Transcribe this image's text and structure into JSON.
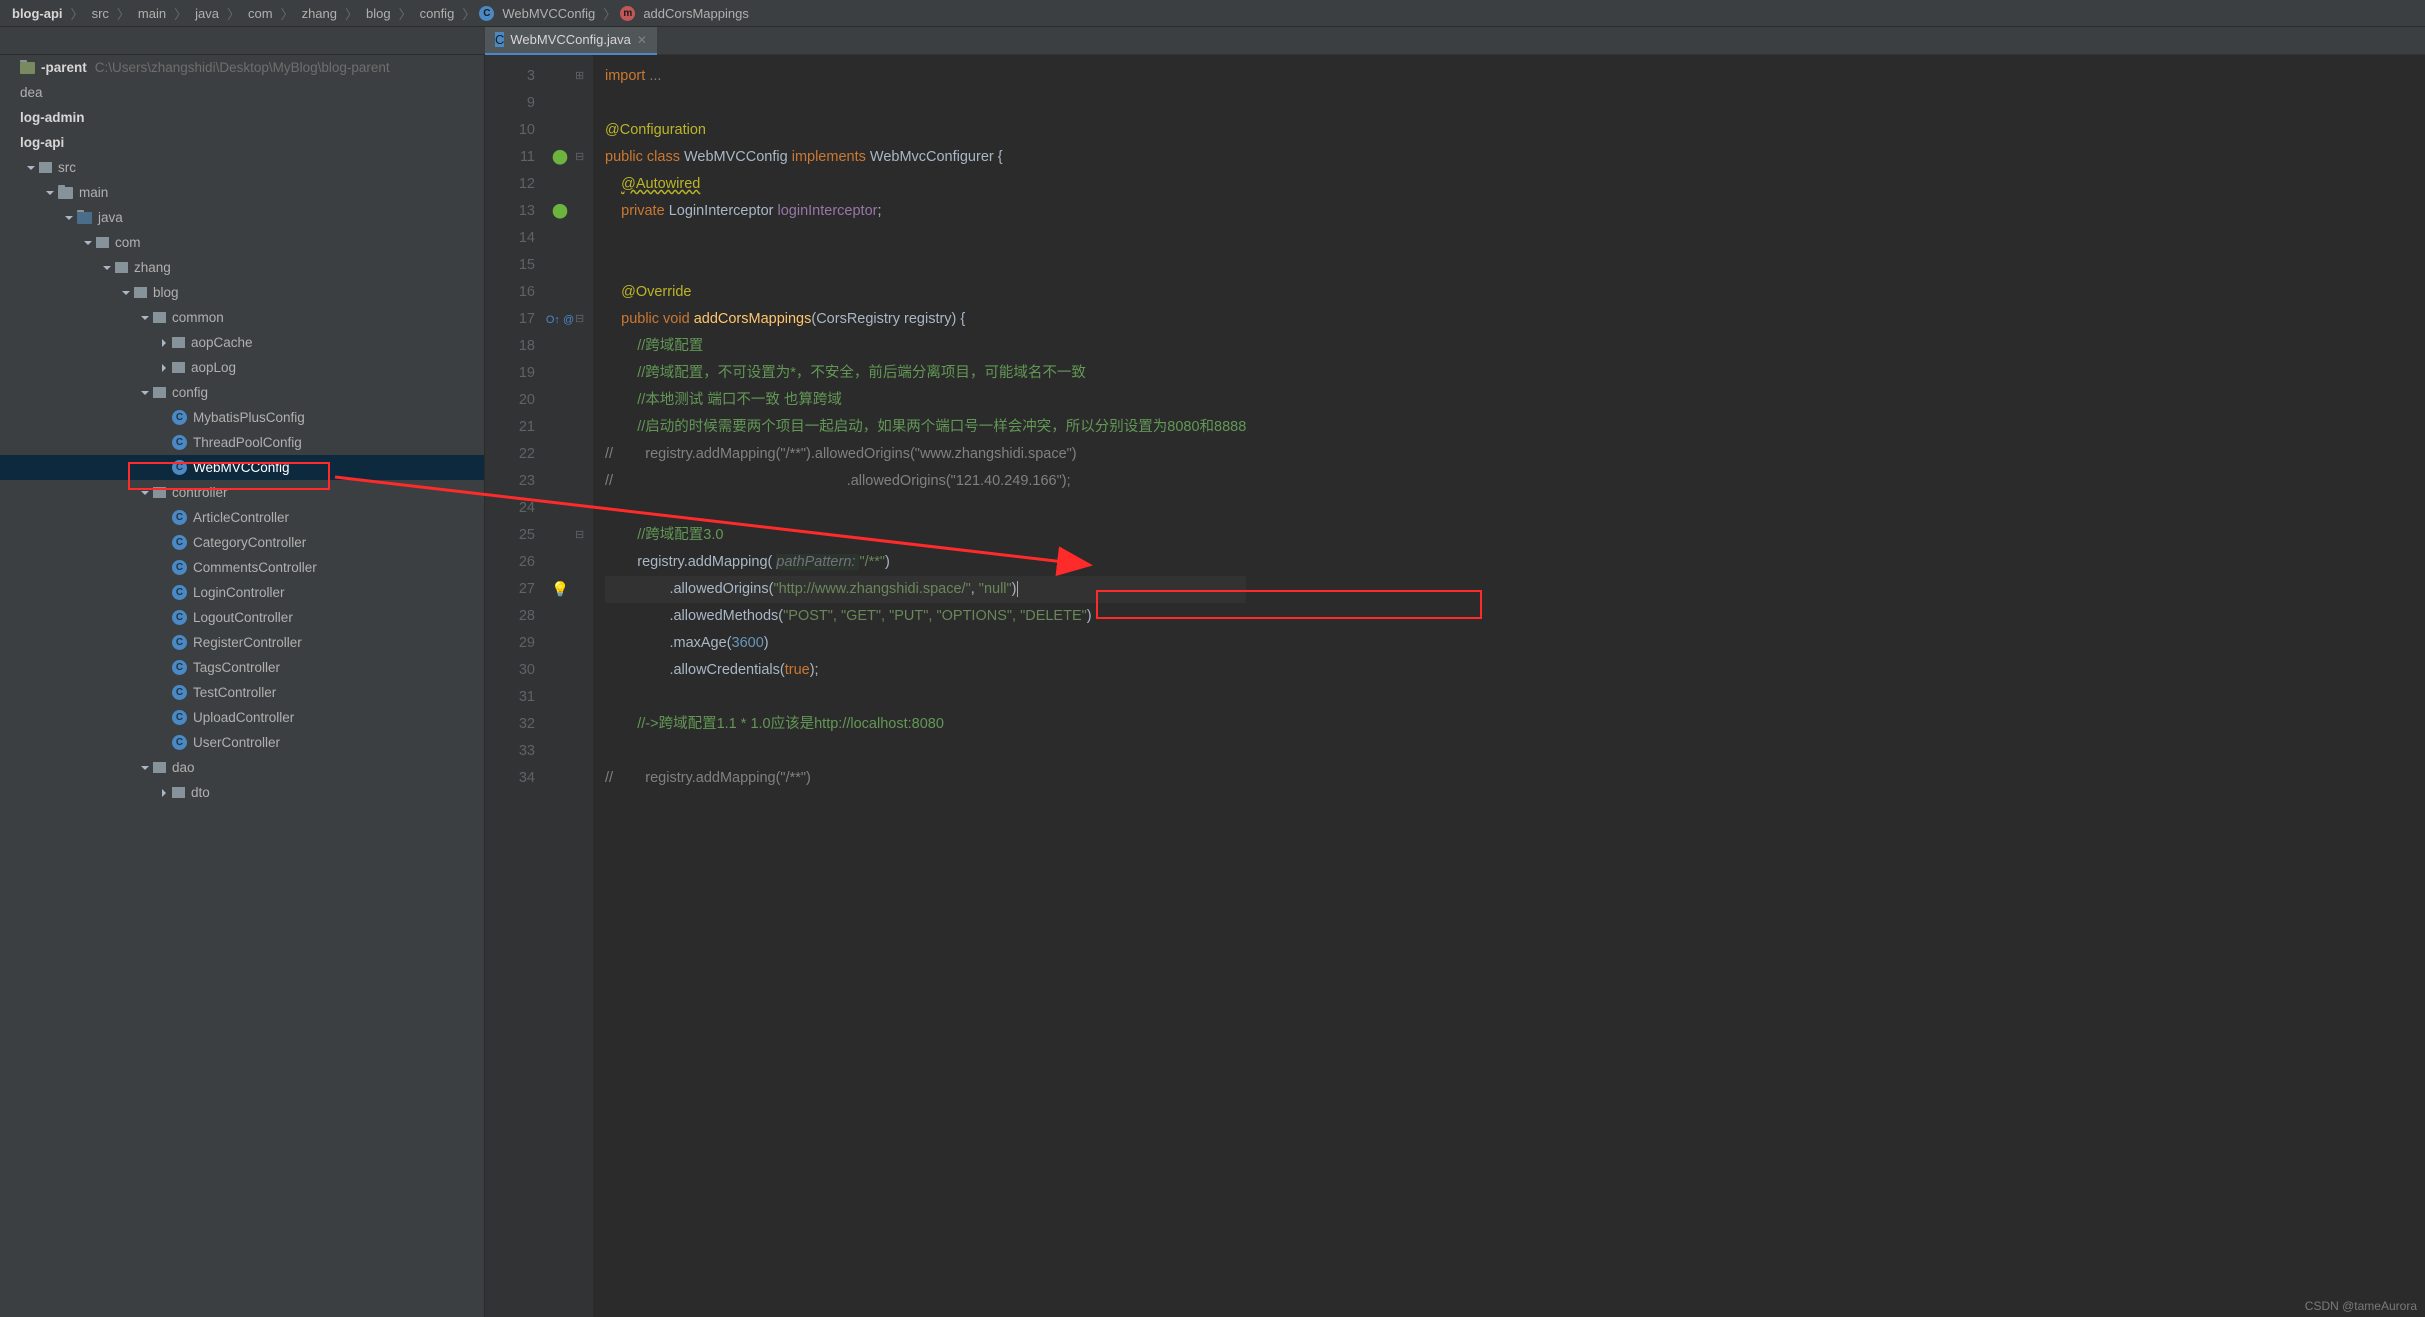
{
  "breadcrumbs": [
    "blog-api",
    "src",
    "main",
    "java",
    "com",
    "zhang",
    "blog",
    "config",
    "WebMVCConfig",
    "addCorsMappings"
  ],
  "tab": {
    "name": "WebMVCConfig.java"
  },
  "project": {
    "root": "-parent",
    "root_path": "C:\\Users\\zhangshidi\\Desktop\\MyBlog\\blog-parent",
    "items": [
      "dea",
      "log-admin",
      "log-api"
    ]
  },
  "tree": [
    {
      "lvl": 0,
      "icon": "root",
      "label": "-parent",
      "extra": "C:\\Users\\zhangshidi\\Desktop\\MyBlog\\blog-parent",
      "bold": true
    },
    {
      "lvl": 0,
      "icon": "",
      "label": "dea"
    },
    {
      "lvl": 0,
      "icon": "",
      "label": "log-admin",
      "bold": true
    },
    {
      "lvl": 0,
      "icon": "",
      "label": "log-api",
      "bold": true
    },
    {
      "lvl": 1,
      "icon": "pkg",
      "label": "src",
      "arrow": "down"
    },
    {
      "lvl": 2,
      "icon": "folder",
      "label": "main",
      "arrow": "down"
    },
    {
      "lvl": 3,
      "icon": "folder",
      "label": "java",
      "arrow": "down",
      "blue": true
    },
    {
      "lvl": 4,
      "icon": "pkg",
      "label": "com",
      "arrow": "down"
    },
    {
      "lvl": 5,
      "icon": "pkg",
      "label": "zhang",
      "arrow": "down"
    },
    {
      "lvl": 6,
      "icon": "pkg",
      "label": "blog",
      "arrow": "down"
    },
    {
      "lvl": 7,
      "icon": "pkg",
      "label": "common",
      "arrow": "down"
    },
    {
      "lvl": 8,
      "icon": "pkg",
      "label": "aopCache",
      "arrow": "right"
    },
    {
      "lvl": 8,
      "icon": "pkg",
      "label": "aopLog",
      "arrow": "right"
    },
    {
      "lvl": 7,
      "icon": "pkg",
      "label": "config",
      "arrow": "down"
    },
    {
      "lvl": 8,
      "icon": "class",
      "label": "MybatisPlusConfig"
    },
    {
      "lvl": 8,
      "icon": "class",
      "label": "ThreadPoolConfig"
    },
    {
      "lvl": 8,
      "icon": "class",
      "label": "WebMVCConfig",
      "selected": true
    },
    {
      "lvl": 7,
      "icon": "pkg",
      "label": "controller",
      "arrow": "down"
    },
    {
      "lvl": 8,
      "icon": "class",
      "label": "ArticleController"
    },
    {
      "lvl": 8,
      "icon": "class",
      "label": "CategoryController"
    },
    {
      "lvl": 8,
      "icon": "class",
      "label": "CommentsController"
    },
    {
      "lvl": 8,
      "icon": "class",
      "label": "LoginController"
    },
    {
      "lvl": 8,
      "icon": "class",
      "label": "LogoutController"
    },
    {
      "lvl": 8,
      "icon": "class",
      "label": "RegisterController"
    },
    {
      "lvl": 8,
      "icon": "class",
      "label": "TagsController"
    },
    {
      "lvl": 8,
      "icon": "class",
      "label": "TestController"
    },
    {
      "lvl": 8,
      "icon": "class",
      "label": "UploadController"
    },
    {
      "lvl": 8,
      "icon": "class",
      "label": "UserController"
    },
    {
      "lvl": 7,
      "icon": "pkg",
      "label": "dao",
      "arrow": "down"
    },
    {
      "lvl": 8,
      "icon": "pkg",
      "label": "dto",
      "arrow": "right"
    }
  ],
  "code": {
    "lines": [
      3,
      9,
      10,
      11,
      12,
      13,
      14,
      15,
      16,
      17,
      18,
      19,
      20,
      21,
      22,
      23,
      24,
      25,
      26,
      27,
      28,
      29,
      30,
      31,
      32,
      33,
      34
    ],
    "l3": "import ...",
    "l10": "@Configuration",
    "l11_pub": "public ",
    "l11_cls": "class ",
    "l11_name": "WebMVCConfig ",
    "l11_imp": "implements ",
    "l11_iface": "WebMvcConfigurer {",
    "l12": "@Autowired",
    "l12_ul": true,
    "l13_priv": "private ",
    "l13_type": "LoginInterceptor ",
    "l13_field": "loginInterceptor",
    "l16": "@Override",
    "l17_pub": "public ",
    "l17_void": "void ",
    "l17_name": "addCorsMappings",
    "l17_sig": "(CorsRegistry registry) {",
    "l18": "//跨域配置",
    "l19": "//跨域配置，不可设置为*，不安全，前后端分离项目，可能域名不一致",
    "l20": "//本地测试 端口不一致 也算跨域",
    "l21": "//启动的时候需要两个项目一起启动，如果两个端口号一样会冲突，所以分别设置为8080和8888",
    "l22": "        registry.addMapping(\"/**\").allowedOrigins(\"www.zhangshidi.space\")",
    "l23": "                                                          .allowedOrigins(\"121.40.249.166\");",
    "l25": "//跨域配置3.0",
    "l26_a": "registry.addMapping( ",
    "l26_h": "pathPattern: ",
    "l26_s": "\"/**\"",
    "l26_e": ")",
    "l27_a": ".allowedOrigins(",
    "l27_s1": "\"http://www.zhangshidi.space/\"",
    "l27_c": ", ",
    "l27_s2": "\"null\"",
    "l27_e": ")",
    "l28_a": ".allowedMethods(",
    "l28_s": "\"POST\", \"GET\", \"PUT\", \"OPTIONS\", \"DELETE\"",
    "l28_e": ")",
    "l29_a": ".maxAge(",
    "l29_n": "3600",
    "l29_e": ")",
    "l30_a": ".allowCredentials(",
    "l30_k": "true",
    "l30_e": ");",
    "l32": "//->跨域配置1.1 * 1.0应该是http://localhost:8080",
    "l34": "        registry.addMapping(\"/**\")"
  },
  "watermark": "CSDN @tameAurora"
}
